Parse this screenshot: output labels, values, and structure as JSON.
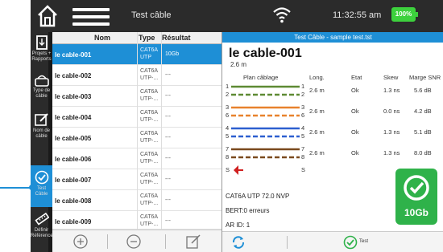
{
  "topbar": {
    "title": "Test câble",
    "time": "11:32:55 am",
    "battery": "100%"
  },
  "sidebar": {
    "items": [
      {
        "label": "Projets + Rapports",
        "icon": "document-icon"
      },
      {
        "label": "Type de câble",
        "icon": "cable-type-icon"
      },
      {
        "label": "Nom de câble",
        "icon": "edit-icon"
      },
      {
        "label": "Test Câble",
        "icon": "check-circle-icon"
      },
      {
        "label": "Définir Référence",
        "icon": "ruler-icon"
      }
    ]
  },
  "list": {
    "headers": {
      "name": "Nom",
      "type": "Type",
      "result": "Résultat"
    },
    "rows": [
      {
        "name": "le cable-001",
        "type1": "CAT6A",
        "type2": "UTP",
        "result": "10Gb"
      },
      {
        "name": "le cable-002",
        "type1": "CAT6A",
        "type2": "UTP-...",
        "result": "---"
      },
      {
        "name": "le cable-003",
        "type1": "CAT6A",
        "type2": "UTP-...",
        "result": "---"
      },
      {
        "name": "le cable-004",
        "type1": "CAT6A",
        "type2": "UTP-...",
        "result": "---"
      },
      {
        "name": "le cable-005",
        "type1": "CAT6A",
        "type2": "UTP-...",
        "result": "---"
      },
      {
        "name": "le cable-006",
        "type1": "CAT6A",
        "type2": "UTP-...",
        "result": "---"
      },
      {
        "name": "le cable-007",
        "type1": "CAT6A",
        "type2": "UTP-...",
        "result": "---"
      },
      {
        "name": "le cable-008",
        "type1": "CAT6A",
        "type2": "UTP-...",
        "result": "---"
      },
      {
        "name": "le cable-009",
        "type1": "CAT6A",
        "type2": "UTP-...",
        "result": "---"
      }
    ]
  },
  "detail": {
    "header": "Test Câble - sample test.tst",
    "cable_name": "le cable-001",
    "cable_length": "2.6 m",
    "columns": {
      "wiremap": "Plan câblage",
      "length": "Long.",
      "state": "Etat",
      "skew": "Skew",
      "snr": "Marge SNR"
    },
    "pairs": [
      {
        "pins_left": [
          "1",
          "2"
        ],
        "pins_right": [
          "1",
          "2"
        ],
        "length": "2.6 m",
        "state": "Ok",
        "skew": "1.3 ns",
        "snr": "5.6 dB"
      },
      {
        "pins_left": [
          "3",
          "6"
        ],
        "pins_right": [
          "3",
          "6"
        ],
        "length": "2.6 m",
        "state": "Ok",
        "skew": "0.0 ns",
        "snr": "4.2 dB"
      },
      {
        "pins_left": [
          "4",
          "5"
        ],
        "pins_right": [
          "4",
          "5"
        ],
        "length": "2.6 m",
        "state": "Ok",
        "skew": "1.3 ns",
        "snr": "5.1 dB"
      },
      {
        "pins_left": [
          "7",
          "8"
        ],
        "pins_right": [
          "7",
          "8"
        ],
        "length": "2.6 m",
        "state": "Ok",
        "skew": "1.3 ns",
        "snr": "8.0 dB"
      }
    ],
    "shield_left": "S",
    "shield_right": "S",
    "info": {
      "cable_type": "CAT6A UTP  72.0 NVP",
      "bert": "BERT:0 erreurs",
      "ar_id": "AR ID: 1"
    },
    "badge": "10Gb",
    "test_button": "Test"
  },
  "colors": {
    "accent": "#1e8fd6",
    "pass_green": "#2fb24a",
    "battery_green": "#3dd13d"
  }
}
